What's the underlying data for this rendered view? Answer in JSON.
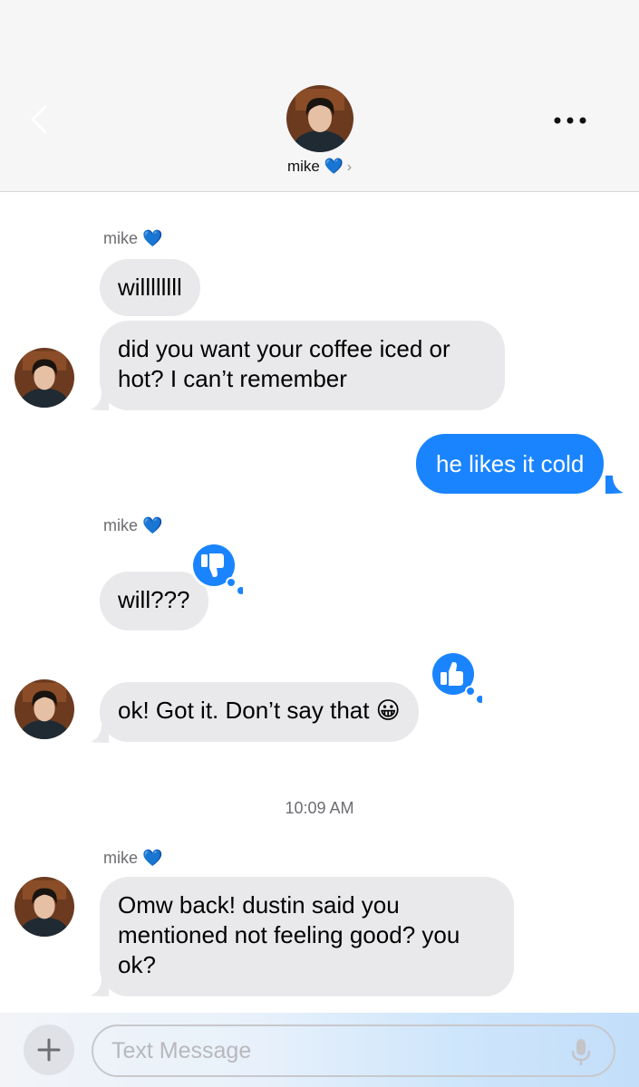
{
  "header": {
    "contact_name": "mike 💙",
    "chevron": "›",
    "icons": {
      "back": "chevron-left-icon",
      "more": "ellipsis-icon"
    }
  },
  "messages": [
    {
      "direction": "in",
      "sender": "mike 💙",
      "text": "willllllll"
    },
    {
      "direction": "in",
      "text": "did you want your coffee iced or hot? I can’t remember"
    },
    {
      "direction": "out",
      "text": "he likes it cold"
    },
    {
      "direction": "in",
      "sender": "mike 💙",
      "text": "will???",
      "reaction": "thumbs-down-icon"
    },
    {
      "direction": "in",
      "text": "ok! Got it. Don’t say that 😀",
      "reaction": "thumbs-up-icon"
    },
    {
      "direction": "in",
      "sender": "mike 💙",
      "text": "Omw back! dustin said you mentioned not feeling good? you ok?"
    }
  ],
  "timestamp": "10:09 AM",
  "composer": {
    "placeholder": "Text Message",
    "plus_label": "+"
  },
  "colors": {
    "outgoing_bubble": "#1a84ff",
    "incoming_bubble": "#e9e9eb",
    "reaction": "#1a84ff"
  }
}
